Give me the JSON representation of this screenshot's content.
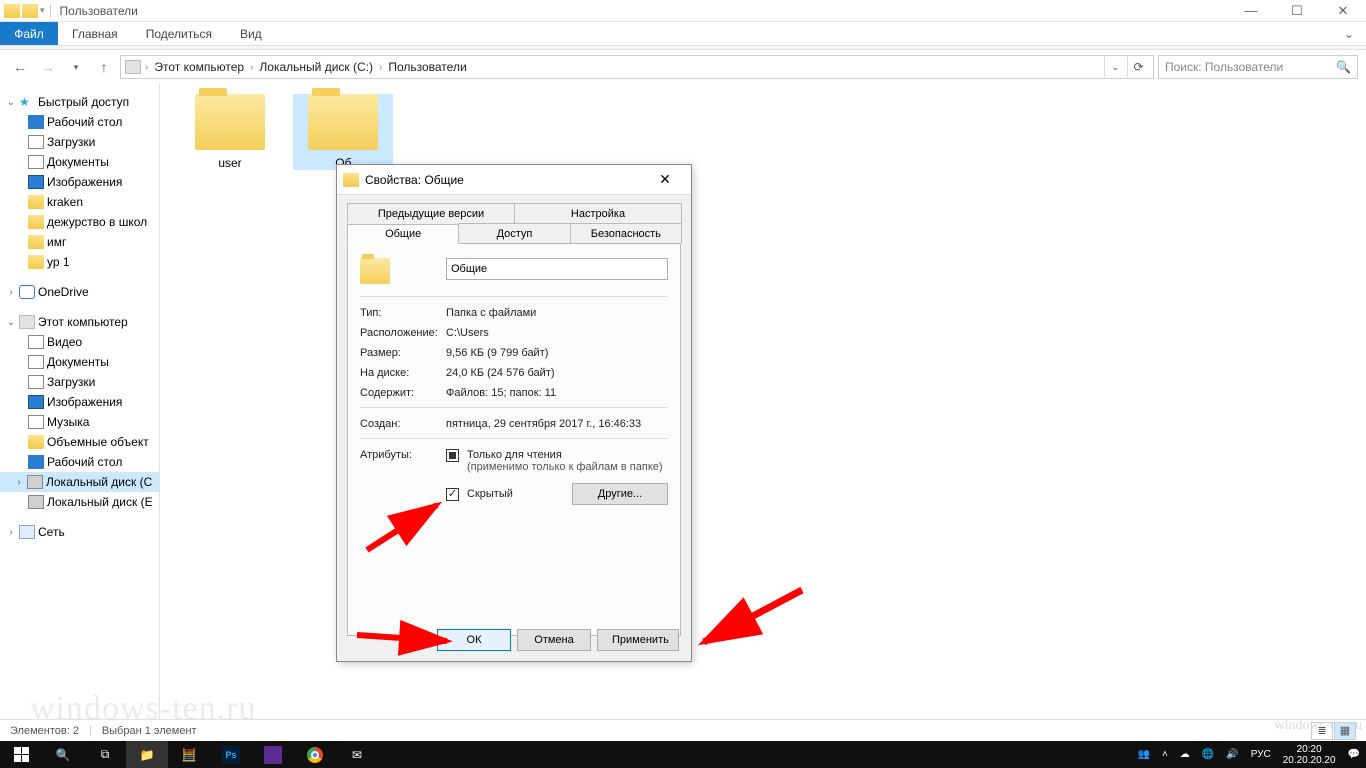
{
  "titlebar": {
    "title": "Пользователи"
  },
  "ribbon": {
    "file": "Файл",
    "tabs": [
      "Главная",
      "Поделиться",
      "Вид"
    ]
  },
  "breadcrumb": [
    "Этот компьютер",
    "Локальный диск (C:)",
    "Пользователи"
  ],
  "search": {
    "placeholder": "Поиск: Пользователи"
  },
  "sidebar": {
    "quick": "Быстрый доступ",
    "quick_items": [
      "Рабочий стол",
      "Загрузки",
      "Документы",
      "Изображения",
      "kraken",
      "дежурство в школ",
      "имг",
      "ур 1"
    ],
    "onedrive": "OneDrive",
    "thispc": "Этот компьютер",
    "pc_items": [
      "Видео",
      "Документы",
      "Загрузки",
      "Изображения",
      "Музыка",
      "Объемные объект",
      "Рабочий стол",
      "Локальный диск (C",
      "Локальный диск (E"
    ],
    "network": "Сеть"
  },
  "folders": [
    {
      "name": "user"
    },
    {
      "name": "Об"
    }
  ],
  "dialog": {
    "title": "Свойства: Общие",
    "tabs_top": [
      "Предыдущие версии",
      "Настройка"
    ],
    "tabs_bot": [
      "Общие",
      "Доступ",
      "Безопасность"
    ],
    "name": "Общие",
    "rows": {
      "type_k": "Тип:",
      "type_v": "Папка с файлами",
      "loc_k": "Расположение:",
      "loc_v": "C:\\Users",
      "size_k": "Размер:",
      "size_v": "9,56 КБ (9 799 байт)",
      "disk_k": "На диске:",
      "disk_v": "24,0 КБ (24 576 байт)",
      "cont_k": "Содержит:",
      "cont_v": "Файлов: 15; папок: 11",
      "created_k": "Создан:",
      "created_v": "пятница, 29 сентября 2017 г., 16:46:33",
      "attr_k": "Атрибуты:",
      "readonly": "Только для чтения",
      "readonly_note": "(применимо только к файлам в папке)",
      "hidden": "Скрытый",
      "other": "Другие..."
    },
    "buttons": {
      "ok": "ОК",
      "cancel": "Отмена",
      "apply": "Применить"
    }
  },
  "statusbar": {
    "count": "Элементов: 2",
    "sel": "Выбран 1 элемент"
  },
  "taskbar": {
    "lang": "РУС",
    "time": "20:20",
    "date": "20.20.20.20"
  },
  "watermark": "windows-ten.ru",
  "watermark2": "windows-ten.ru"
}
